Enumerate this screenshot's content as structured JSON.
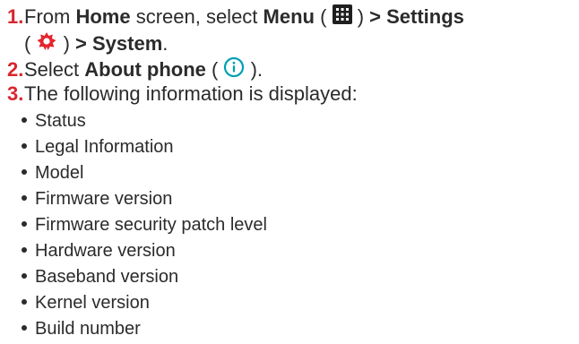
{
  "steps": [
    {
      "number": "1.",
      "part_from": "From ",
      "home": "Home",
      "part_screen": " screen, select ",
      "menu": "Menu",
      "paren_open": " (",
      "paren_close": ") ",
      "settings": "> Settings",
      "line2_open": "(",
      "line2_close": ") ",
      "system": "> System",
      "period": "."
    },
    {
      "number": "2.",
      "part_select": "Select ",
      "about": "About phone",
      "paren_open": " (",
      "paren_close": ")."
    },
    {
      "number": "3.",
      "text": "The following information is displayed:"
    }
  ],
  "info_items": [
    "Status",
    "Legal Information",
    "Model",
    "Firmware version",
    "Firmware security patch level",
    "Hardware version",
    "Baseband version",
    "Kernel version",
    "Build number"
  ],
  "icons": {
    "menu": "menu-grid-icon",
    "settings": "settings-gear-icon",
    "about": "info-circle-icon"
  },
  "colors": {
    "step_number": "#d8262f",
    "text": "#2b2b2b",
    "settings_icon": "#e4252f",
    "info_icon": "#00a0b4",
    "menu_icon": "#1f1f1f"
  }
}
